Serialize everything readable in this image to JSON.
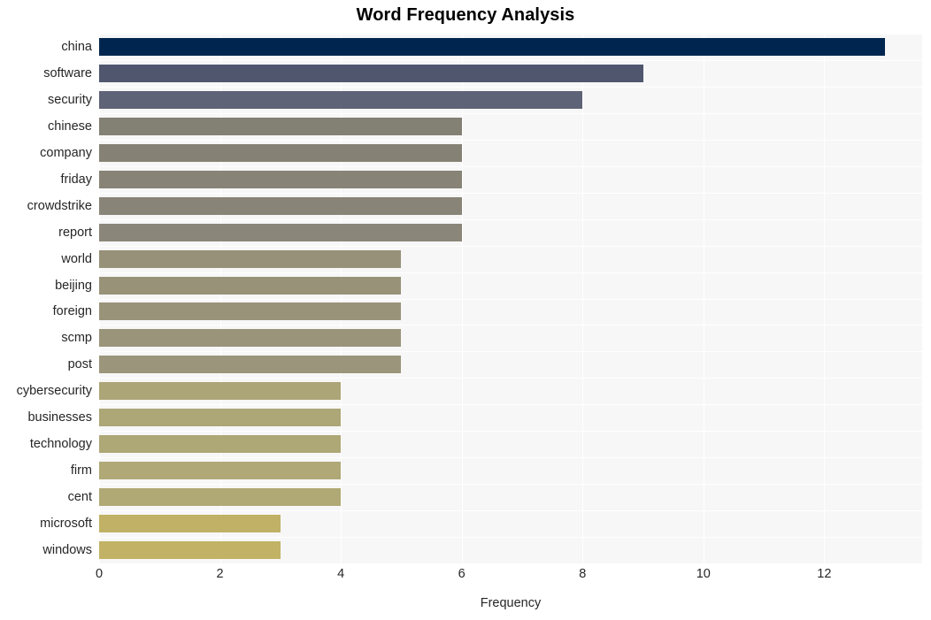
{
  "chart_data": {
    "type": "bar",
    "orientation": "horizontal",
    "title": "Word Frequency Analysis",
    "xlabel": "Frequency",
    "ylabel": "",
    "xlim": [
      0,
      13.62
    ],
    "xticks": [
      0,
      2,
      4,
      6,
      8,
      10,
      12
    ],
    "xtick_labels": [
      "0",
      "2",
      "4",
      "6",
      "8",
      "10",
      "12"
    ],
    "grid": true,
    "grid_axis": "x",
    "legend": false,
    "categories": [
      "china",
      "software",
      "security",
      "chinese",
      "company",
      "friday",
      "crowdstrike",
      "report",
      "world",
      "beijing",
      "foreign",
      "scmp",
      "post",
      "cybersecurity",
      "businesses",
      "technology",
      "firm",
      "cent",
      "microsoft",
      "windows"
    ],
    "values": [
      13,
      9,
      8,
      6,
      6,
      6,
      6,
      6,
      5,
      5,
      5,
      5,
      5,
      4,
      4,
      4,
      4,
      4,
      3,
      3
    ],
    "bar_colors": [
      "#00264f",
      "#4f566e",
      "#5f6377",
      "#838074",
      "#858275",
      "#878376",
      "#888477",
      "#8a8679",
      "#979179",
      "#989279",
      "#99937a",
      "#9a947a",
      "#9b957b",
      "#aca577",
      "#ada677",
      "#aea776",
      "#b0a876",
      "#b1a975",
      "#c0b166",
      "#c1b265"
    ],
    "plot_background": "#f7f7f7",
    "gridline_color": "#ffffff",
    "title_color": "#000000",
    "tick_color": "#262626",
    "figure_background": "#ffffff"
  }
}
